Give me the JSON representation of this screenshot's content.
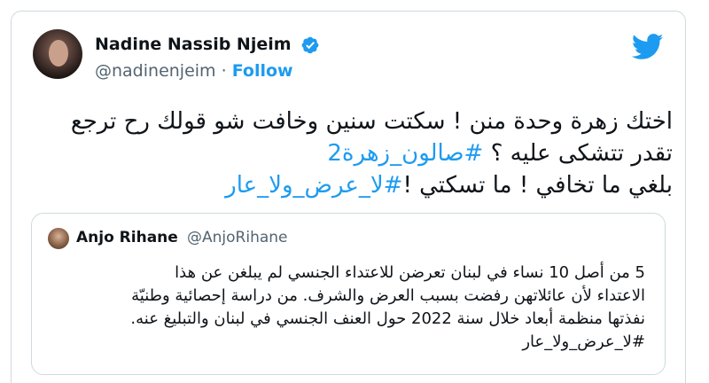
{
  "author": {
    "name": "Nadine Nassib Njeim",
    "handle": "@nadinenjeim",
    "separator": "·",
    "follow_label": "Follow"
  },
  "tweet": {
    "line1": "اختك زهرة وحدة منن ! سكتت سنين وخافت شو قولك رح ترجع",
    "line2_text": "تقدر تتشكى عليه ؟ ",
    "line2_tag": "#صالون_زهرة2",
    "line3_tag": "#لا_عرض_ولا_عار",
    "line3_text": "  بلغي ما تخافي ! ما تسكتي !"
  },
  "quoted": {
    "name": "Anjo Rihane",
    "handle": "@AnjoRihane",
    "lines": [
      "5 من أصل 10 نساء في لبنان تعرضن للاعتداء الجنسي لم يبلغن عن هذا",
      "الاعتداء لأن عائلاتهن رفضت بسبب العرض والشرف. من دراسة إحصائية وطنيّة",
      "نفذتها منظمة أبعاد خلال سنة 2022 حول العنف الجنسي في لبنان والتبليغ عنه.",
      "#لا_عرض_ولا_عار"
    ]
  },
  "icons": {
    "verified": "verified-badge-icon",
    "platform": "twitter-bird-icon"
  },
  "colors": {
    "accent": "#1d9bf0",
    "text": "#0f1419",
    "muted": "#536471",
    "border": "#cfd9de"
  }
}
